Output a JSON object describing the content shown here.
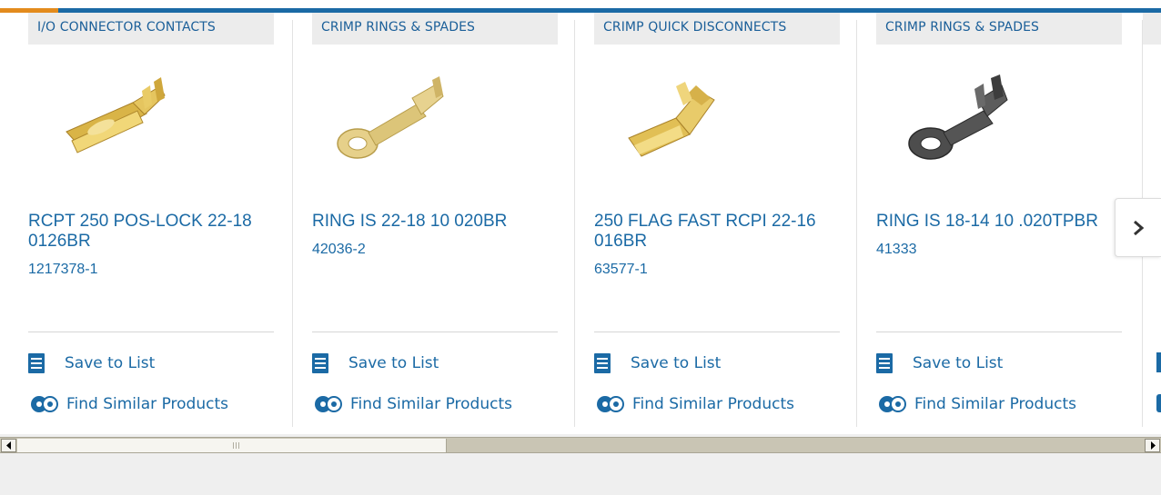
{
  "products": [
    {
      "category": "I/O CONNECTOR CONTACTS",
      "title_line1": "RCPT 250 POS-LOCK 22-18",
      "title_line2": "0126BR",
      "part_number": "1217378-1",
      "image": "brass-receptacle-terminal",
      "image_color": "#d8b34a"
    },
    {
      "category": "CRIMP RINGS & SPADES",
      "title_line1": "RING IS 22-18 10 020BR",
      "title_line2": "",
      "part_number": "42036-2",
      "image": "brass-ring-terminal",
      "image_color": "#dcc579"
    },
    {
      "category": "CRIMP QUICK DISCONNECTS",
      "title_line1": "250 FLAG FAST RCPI 22-16",
      "title_line2": "016BR",
      "part_number": "63577-1",
      "image": "brass-flag-disconnect",
      "image_color": "#d8b34a"
    },
    {
      "category": "CRIMP RINGS & SPADES",
      "title_line1": "RING IS 18-14 10 .020TPBR",
      "title_line2": "",
      "part_number": "41333",
      "image": "tin-ring-terminal",
      "image_color": "#4a4a4a"
    }
  ],
  "actions": {
    "save_label": "Save to List",
    "find_label": "Find Similar Products"
  },
  "carousel": {
    "next_icon": "chevron-right-icon"
  },
  "colors": {
    "link_blue": "#1b6aa5",
    "accent_orange": "#e38b1d",
    "category_bg": "#ececec"
  }
}
